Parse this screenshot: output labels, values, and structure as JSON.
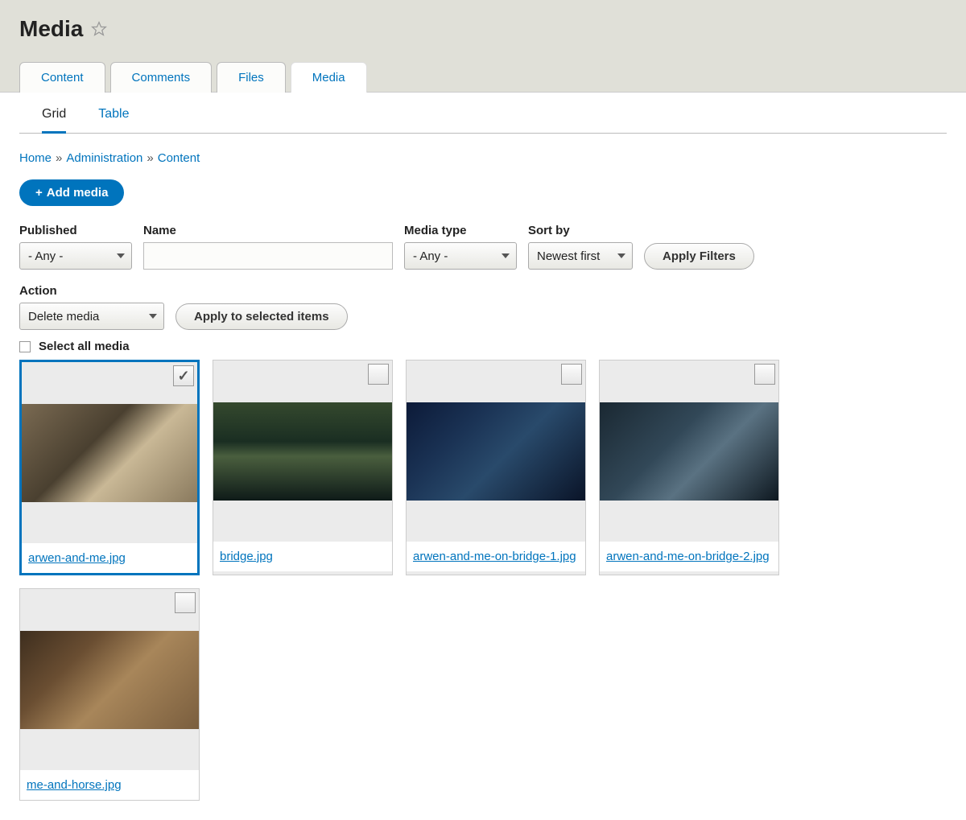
{
  "page_title": "Media",
  "primary_tabs": [
    {
      "label": "Content",
      "active": false
    },
    {
      "label": "Comments",
      "active": false
    },
    {
      "label": "Files",
      "active": false
    },
    {
      "label": "Media",
      "active": true
    }
  ],
  "secondary_tabs": [
    {
      "label": "Grid",
      "active": true
    },
    {
      "label": "Table",
      "active": false
    }
  ],
  "breadcrumb": [
    {
      "label": "Home"
    },
    {
      "label": "Administration"
    },
    {
      "label": "Content"
    }
  ],
  "add_button_label": "Add media",
  "filters": {
    "published": {
      "label": "Published",
      "value": "- Any -"
    },
    "name": {
      "label": "Name",
      "value": ""
    },
    "media_type": {
      "label": "Media type",
      "value": "- Any -"
    },
    "sort_by": {
      "label": "Sort by",
      "value": "Newest first"
    },
    "apply_label": "Apply Filters"
  },
  "action": {
    "label": "Action",
    "value": "Delete media",
    "apply_label": "Apply to selected items"
  },
  "select_all_label": "Select all media",
  "media_items": [
    {
      "filename": "arwen-and-me.jpg",
      "selected": true,
      "thumb_class": "t0"
    },
    {
      "filename": "bridge.jpg",
      "selected": false,
      "thumb_class": "t1"
    },
    {
      "filename": "arwen-and-me-on-bridge-1.jpg",
      "selected": false,
      "thumb_class": "t2"
    },
    {
      "filename": "arwen-and-me-on-bridge-2.jpg",
      "selected": false,
      "thumb_class": "t3"
    },
    {
      "filename": "me-and-horse.jpg",
      "selected": false,
      "thumb_class": "t4"
    }
  ]
}
